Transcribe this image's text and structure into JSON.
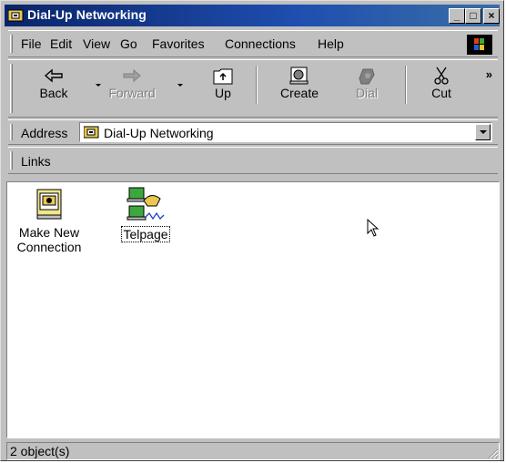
{
  "window": {
    "title": "Dial-Up Networking"
  },
  "title_buttons": {
    "minimize": "_",
    "maximize": "□",
    "close": "×"
  },
  "menu": [
    {
      "label": "File"
    },
    {
      "label": "Edit"
    },
    {
      "label": "View"
    },
    {
      "label": "Go"
    },
    {
      "label": "Favorites"
    },
    {
      "label": "Connections"
    },
    {
      "label": "Help"
    }
  ],
  "toolbar": {
    "back": "Back",
    "forward": "Forward",
    "up": "Up",
    "create": "Create",
    "dial": "Dial",
    "cut": "Cut",
    "more": "»"
  },
  "address": {
    "label": "Address",
    "value": "Dial-Up Networking"
  },
  "links": {
    "label": "Links"
  },
  "items": [
    {
      "label_line1": "Make New",
      "label_line2": "Connection"
    },
    {
      "label_line1": "Telpage",
      "label_line2": ""
    }
  ],
  "status": {
    "text": "2 object(s)"
  }
}
